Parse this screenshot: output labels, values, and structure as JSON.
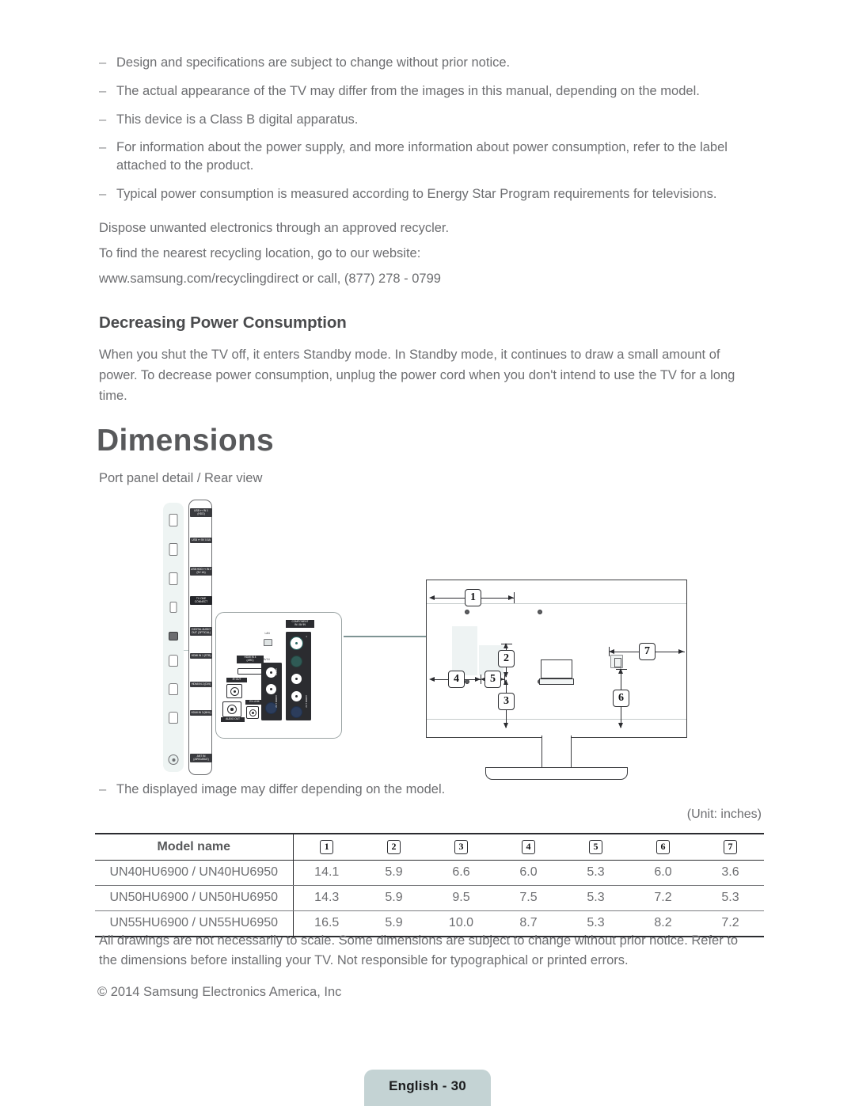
{
  "notes": [
    "Design and specifications are subject to change without prior notice.",
    "The actual appearance of the TV may differ from the images in this manual, depending on the model.",
    "This device is a Class B digital apparatus.",
    "For information about the power supply, and more information about power consumption, refer to the label attached to the product.",
    "Typical power consumption is measured according to Energy Star Program requirements for televisions."
  ],
  "dash": "–",
  "recycling": {
    "line1": "Dispose unwanted electronics through an approved recycler.",
    "line2": "To find the nearest recycling location, go to our website:",
    "line3": "www.samsung.com/recyclingdirect or call, (877) 278 - 0799"
  },
  "power_section": {
    "heading": "Decreasing Power Consumption",
    "body": "When you shut the TV off, it enters Standby mode. In Standby mode, it continues to draw a small amount of power. To decrease power consumption, unplug the power cord when you don't intend to use the TV for a long time."
  },
  "dimensions_section": {
    "heading": "Dimensions",
    "caption": "Port panel detail / Rear view",
    "note": "The displayed image may differ depending on the model.",
    "unit": "(Unit: inches)"
  },
  "port_labels": [
    "USB ⊷\nIN 1 (HDD)",
    "USB ⊷\n5V 0.5A",
    "USB HDD ⊷\nIN 2 (5V 1A)",
    "TV\nONE\nCONNECT",
    "DIGITAL\nAUDIO OUT\n(OPTICAL)",
    "HDMI IN 1\n(STB)",
    "HDMI IN 2\n(DVI)",
    "HDMI IN 3\n(MHL)",
    "ANT IN\n(AIR/CABLE)"
  ],
  "detail_panel_labels": {
    "lan": "LAN",
    "hdmi4": "HDMI IN 4\n(ARC)",
    "ir_out": "IR OUT",
    "audio_out": "AUDIO OUT",
    "ex_link": "EX-LINK",
    "av_in": "AV IN",
    "component_in": "COMPONENT\nIN / AV IN",
    "video": "VIDEO",
    "audio_lr": "AUDIO L / R",
    "pr": "PR",
    "pb": "PB",
    "y": "Y"
  },
  "callouts": [
    "1",
    "2",
    "3",
    "4",
    "5",
    "6",
    "7"
  ],
  "table": {
    "headers": [
      "Model name",
      "1",
      "2",
      "3",
      "4",
      "5",
      "6",
      "7"
    ],
    "rows": [
      {
        "model": "UN40HU6900 / UN40HU6950",
        "values": [
          "14.1",
          "5.9",
          "6.6",
          "6.0",
          "5.3",
          "6.0",
          "3.6"
        ]
      },
      {
        "model": "UN50HU6900 / UN50HU6950",
        "values": [
          "14.3",
          "5.9",
          "9.5",
          "7.5",
          "5.3",
          "7.2",
          "5.3"
        ]
      },
      {
        "model": "UN55HU6900 / UN55HU6950",
        "values": [
          "16.5",
          "5.9",
          "10.0",
          "8.7",
          "5.3",
          "8.2",
          "7.2"
        ]
      }
    ]
  },
  "footer": {
    "disclaimer": "All drawings are not necessarily to scale. Some dimensions are subject to change without prior notice. Refer to the dimensions before installing your TV. Not responsible for typographical or printed errors.",
    "copyright": "© 2014 Samsung Electronics America, Inc",
    "page_label": "English - 30"
  },
  "colors": {
    "text": "#6d6e71",
    "heading": "#58595b",
    "badge_bg": "#c4d3d4",
    "panel_fill": "#eef3f3",
    "arrow": "#7e9494"
  }
}
